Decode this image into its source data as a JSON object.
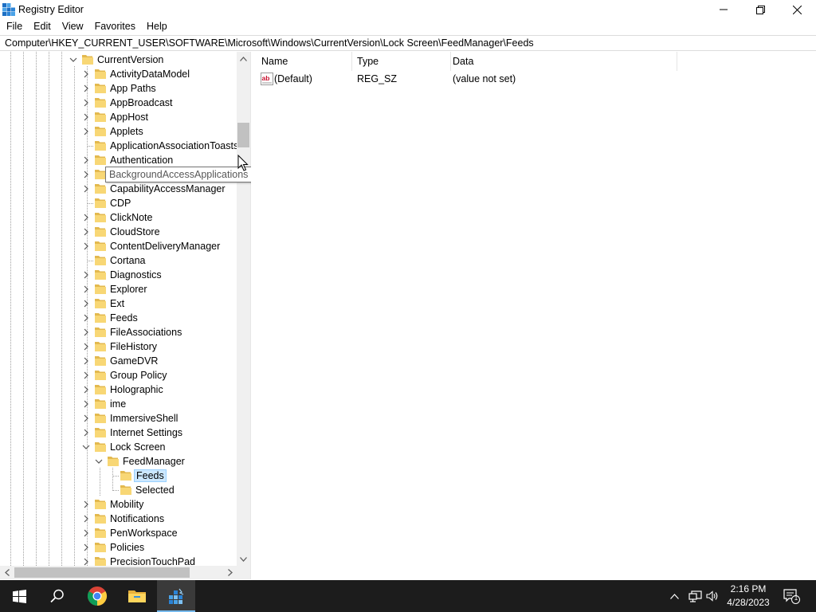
{
  "window": {
    "title": "Registry Editor",
    "minimize_icon": "minimize-icon",
    "restore_icon": "restore-icon",
    "close_icon": "close-icon"
  },
  "menu": [
    "File",
    "Edit",
    "View",
    "Favorites",
    "Help"
  ],
  "address": {
    "path": "Computer\\HKEY_CURRENT_USER\\SOFTWARE\\Microsoft\\Windows\\CurrentVersion\\Lock Screen\\FeedManager\\Feeds"
  },
  "tree": {
    "items": [
      {
        "label": "CurrentVersion",
        "level": 0,
        "expander": "expanded"
      },
      {
        "label": "ActivityDataModel",
        "level": 1,
        "expander": "collapsed"
      },
      {
        "label": "App Paths",
        "level": 1,
        "expander": "collapsed"
      },
      {
        "label": "AppBroadcast",
        "level": 1,
        "expander": "collapsed"
      },
      {
        "label": "AppHost",
        "level": 1,
        "expander": "collapsed"
      },
      {
        "label": "Applets",
        "level": 1,
        "expander": "collapsed"
      },
      {
        "label": "ApplicationAssociationToasts",
        "level": 1,
        "expander": "none"
      },
      {
        "label": "Authentication",
        "level": 1,
        "expander": "collapsed"
      },
      {
        "label": "BackgroundAccessApplications",
        "level": 1,
        "expander": "collapsed"
      },
      {
        "label": "CapabilityAccessManager",
        "level": 1,
        "expander": "collapsed"
      },
      {
        "label": "CDP",
        "level": 1,
        "expander": "none"
      },
      {
        "label": "ClickNote",
        "level": 1,
        "expander": "collapsed"
      },
      {
        "label": "CloudStore",
        "level": 1,
        "expander": "collapsed"
      },
      {
        "label": "ContentDeliveryManager",
        "level": 1,
        "expander": "collapsed"
      },
      {
        "label": "Cortana",
        "level": 1,
        "expander": "none"
      },
      {
        "label": "Diagnostics",
        "level": 1,
        "expander": "collapsed"
      },
      {
        "label": "Explorer",
        "level": 1,
        "expander": "collapsed"
      },
      {
        "label": "Ext",
        "level": 1,
        "expander": "collapsed"
      },
      {
        "label": "Feeds",
        "level": 1,
        "expander": "collapsed"
      },
      {
        "label": "FileAssociations",
        "level": 1,
        "expander": "collapsed"
      },
      {
        "label": "FileHistory",
        "level": 1,
        "expander": "collapsed"
      },
      {
        "label": "GameDVR",
        "level": 1,
        "expander": "collapsed"
      },
      {
        "label": "Group Policy",
        "level": 1,
        "expander": "collapsed"
      },
      {
        "label": "Holographic",
        "level": 1,
        "expander": "collapsed"
      },
      {
        "label": "ime",
        "level": 1,
        "expander": "collapsed"
      },
      {
        "label": "ImmersiveShell",
        "level": 1,
        "expander": "collapsed"
      },
      {
        "label": "Internet Settings",
        "level": 1,
        "expander": "collapsed"
      },
      {
        "label": "Lock Screen",
        "level": 1,
        "expander": "expanded"
      },
      {
        "label": "FeedManager",
        "level": 2,
        "expander": "expanded"
      },
      {
        "label": "Feeds",
        "level": 3,
        "expander": "none",
        "selected": true
      },
      {
        "label": "Selected",
        "level": 3,
        "expander": "none"
      },
      {
        "label": "Mobility",
        "level": 1,
        "expander": "collapsed"
      },
      {
        "label": "Notifications",
        "level": 1,
        "expander": "collapsed"
      },
      {
        "label": "PenWorkspace",
        "level": 1,
        "expander": "collapsed"
      },
      {
        "label": "Policies",
        "level": 1,
        "expander": "collapsed"
      },
      {
        "label": "PrecisionTouchPad",
        "level": 1,
        "expander": "collapsed"
      }
    ]
  },
  "tooltip": {
    "text": "BackgroundAccessApplications"
  },
  "list": {
    "columns": [
      "Name",
      "Type",
      "Data"
    ],
    "rows": [
      {
        "name": "(Default)",
        "type": "REG_SZ",
        "data": "(value not set)",
        "icon": "string-value-icon"
      }
    ]
  },
  "taskbar": {
    "apps": [
      "start-icon",
      "search-icon",
      "chrome-icon",
      "file-explorer-icon",
      "registry-editor-icon"
    ],
    "active_app": "registry-editor-icon",
    "time": "2:16 PM",
    "date": "4/28/2023",
    "notification_count": "1"
  },
  "colors": {
    "selection": "#cce8ff",
    "folder": "#f8d775",
    "taskbar": "#1c1c1c",
    "taskbar_accent": "#76b9ed"
  }
}
